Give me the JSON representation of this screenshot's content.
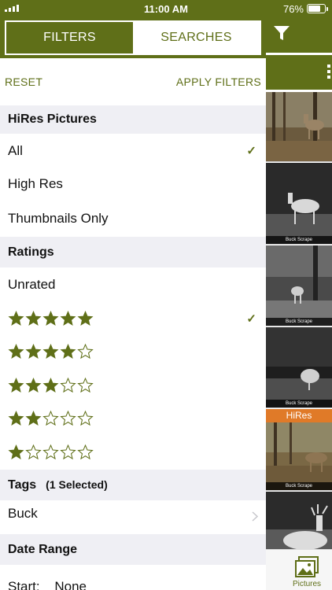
{
  "status_bar": {
    "time": "11:00 AM",
    "battery": "76%"
  },
  "tabs": [
    {
      "label": "FILTERS",
      "active": true
    },
    {
      "label": "SEARCHES",
      "active": false
    }
  ],
  "actions": {
    "reset": "RESET",
    "apply": "APPLY FILTERS"
  },
  "hires": {
    "title": "HiRes Pictures",
    "options": [
      "All",
      "High Res",
      "Thumbnails Only"
    ],
    "selected": "All"
  },
  "ratings": {
    "title": "Ratings",
    "unrated_label": "Unrated",
    "star_rows": [
      5,
      4,
      3,
      2,
      1
    ],
    "selected_stars": 5
  },
  "tags": {
    "title": "Tags",
    "count_label": "(1 Selected)",
    "value": "Buck"
  },
  "date_range": {
    "title": "Date Range",
    "start_label": "Start:",
    "start_value": "None"
  },
  "background": {
    "thumb_caption": "Buck Scrape",
    "hires_badge": "HiRes",
    "bottom_tab_label": "Pictures"
  },
  "colors": {
    "accent": "#5f6f18",
    "section_bg": "#efeff4",
    "hires_badge": "#e07a28"
  },
  "icons": [
    "signal-icon",
    "battery-icon",
    "filter-icon",
    "grid-icon",
    "checkmark-icon",
    "star-filled-icon",
    "star-empty-icon",
    "chevron-right-icon",
    "pictures-icon"
  ]
}
